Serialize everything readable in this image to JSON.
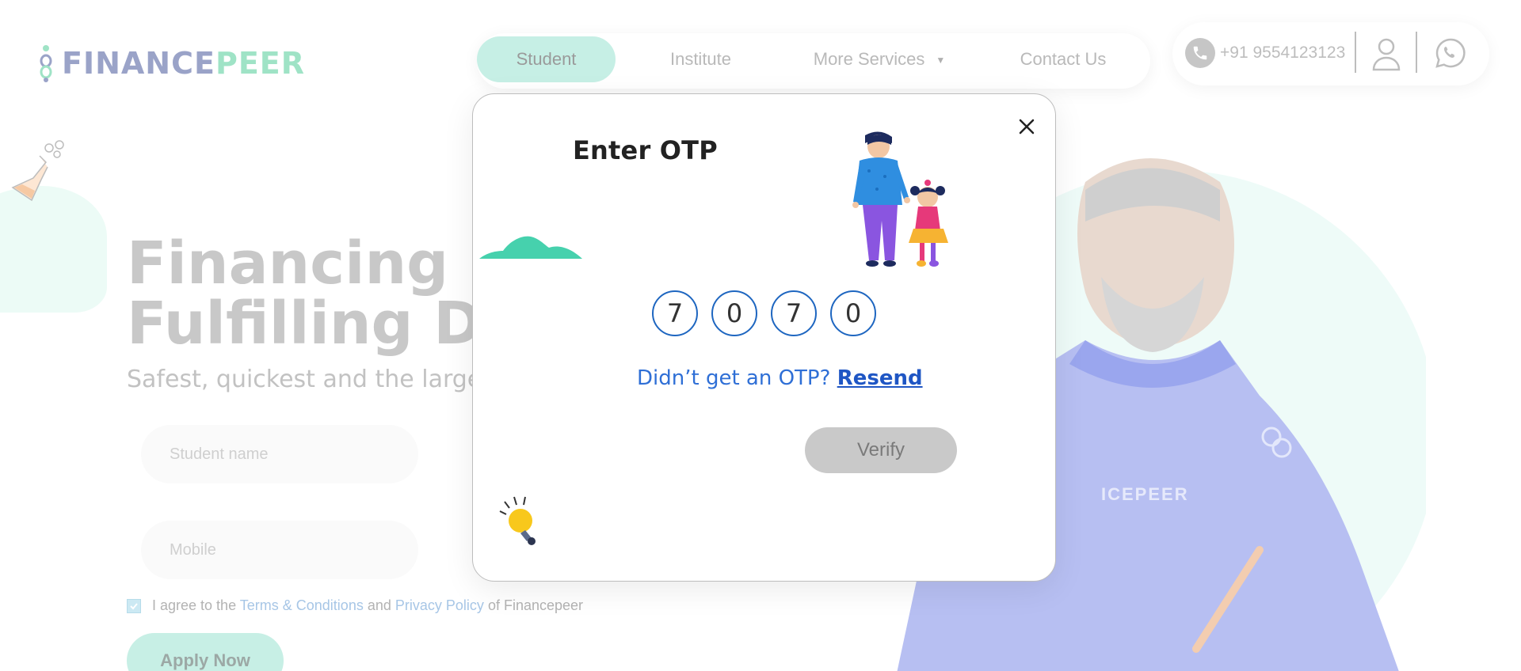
{
  "brand": {
    "logo_part1": "FINANCE",
    "logo_part2": "PEER"
  },
  "nav": {
    "items": [
      {
        "label": "Student",
        "active": true
      },
      {
        "label": "Institute",
        "active": false
      },
      {
        "label": "More Services",
        "active": false
      },
      {
        "label": "Contact Us",
        "active": false
      }
    ]
  },
  "contact": {
    "phone": "+91 9554123123"
  },
  "hero": {
    "title_line1": "Financing Ed",
    "title_line2": "Fulfilling Dre",
    "subtitle": "Safest, quickest and the largest e"
  },
  "form": {
    "student_name_placeholder": "Student name",
    "mobile_placeholder": "Mobile",
    "agree_prefix": "I agree to the",
    "terms_link": "Terms & Conditions",
    "agree_and": "and",
    "privacy_link": "Privacy Policy",
    "agree_suffix": "of Financepeer",
    "agree_checked": true,
    "apply_label": "Apply Now"
  },
  "jersey_text": "ICEPEER",
  "modal": {
    "title": "Enter OTP",
    "otp_digits": [
      "7",
      "0",
      "7",
      "0"
    ],
    "resend_prompt": "Didn’t get an OTP?",
    "resend_link": "Resend",
    "verify_label": "Verify"
  },
  "colors": {
    "accent_mint": "#c6efe5",
    "link_blue": "#1f56c4",
    "otp_border": "#1e66c0",
    "disabled_button": "#c9c9c9"
  }
}
